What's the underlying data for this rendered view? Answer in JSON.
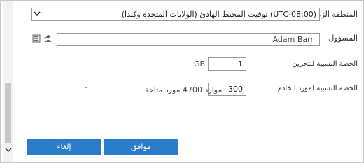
{
  "form": {
    "timezone_label": "المنطقة الزمنية",
    "timezone_value": "(UTC-08:00) توقيت المحيط الهادئ (الولايات المتحدة وكندا)",
    "admin_label": "المسؤول",
    "admin_value": "Adam Barr",
    "storage_quota_label": "الحصة النسبية للتخزين",
    "storage_quota_value": "1",
    "storage_quota_unit": "GB",
    "resource_quota_label": "الحصة النسبية لمورد الخادم",
    "resource_quota_value": "300",
    "resource_quota_unit": "موارد 4700 مورد متاحة"
  },
  "buttons": {
    "ok_label": "موافق",
    "cancel_label": "إلغاء"
  },
  "icons": {
    "address_book": "address-book-icon",
    "check_names": "check-names-icon",
    "dropdown": "chevron-down-icon"
  },
  "colors": {
    "button_blue": "#2b7cc9"
  }
}
